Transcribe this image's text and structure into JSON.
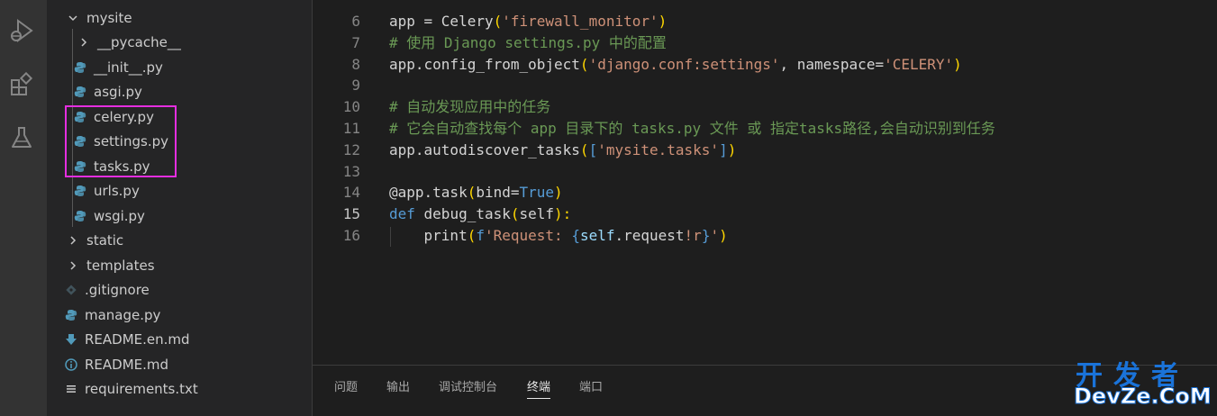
{
  "activity_bar": {
    "icons": [
      "run-debug-icon",
      "extensions-icon",
      "testing-flask-icon"
    ]
  },
  "explorer": {
    "items": [
      {
        "label": "mysite",
        "kind": "folder-open"
      },
      {
        "label": "__pycache__",
        "kind": "folder-closed"
      },
      {
        "label": "__init__.py",
        "kind": "python-file"
      },
      {
        "label": "asgi.py",
        "kind": "python-file"
      },
      {
        "label": "celery.py",
        "kind": "python-file"
      },
      {
        "label": "settings.py",
        "kind": "python-file"
      },
      {
        "label": "tasks.py",
        "kind": "python-file"
      },
      {
        "label": "urls.py",
        "kind": "python-file"
      },
      {
        "label": "wsgi.py",
        "kind": "python-file"
      },
      {
        "label": "static",
        "kind": "folder-closed"
      },
      {
        "label": "templates",
        "kind": "folder-closed"
      },
      {
        "label": ".gitignore",
        "kind": "git-file"
      },
      {
        "label": "manage.py",
        "kind": "python-file"
      },
      {
        "label": "README.en.md",
        "kind": "markdown-download-file"
      },
      {
        "label": "README.md",
        "kind": "markdown-info-file"
      },
      {
        "label": "requirements.txt",
        "kind": "text-file"
      }
    ],
    "highlight_color": "#e52ee0"
  },
  "editor": {
    "active_line": 15,
    "lines": [
      {
        "num": "6",
        "tokens": [
          {
            "t": "app = Celery",
            "c": "plain"
          },
          {
            "t": "(",
            "c": "brk"
          },
          {
            "t": "'firewall_monitor'",
            "c": "str"
          },
          {
            "t": ")",
            "c": "brk"
          }
        ]
      },
      {
        "num": "7",
        "tokens": [
          {
            "t": "# 使用 Django settings.py 中的配置",
            "c": "comment"
          }
        ]
      },
      {
        "num": "8",
        "tokens": [
          {
            "t": "app.config_from_object",
            "c": "plain"
          },
          {
            "t": "(",
            "c": "brk"
          },
          {
            "t": "'django.conf:settings'",
            "c": "str"
          },
          {
            "t": ", namespace=",
            "c": "plain"
          },
          {
            "t": "'CELERY'",
            "c": "str"
          },
          {
            "t": ")",
            "c": "brk"
          }
        ]
      },
      {
        "num": "9",
        "tokens": []
      },
      {
        "num": "10",
        "tokens": [
          {
            "t": "# 自动发现应用中的任务",
            "c": "comment"
          }
        ]
      },
      {
        "num": "11",
        "tokens": [
          {
            "t": "# 它会自动查找每个 app 目录下的 tasks.py 文件 或 指定tasks路径,会自动识别到任务",
            "c": "comment"
          }
        ]
      },
      {
        "num": "12",
        "tokens": [
          {
            "t": "app.autodiscover_tasks",
            "c": "plain"
          },
          {
            "t": "(",
            "c": "brk"
          },
          {
            "t": "[",
            "c": "kw"
          },
          {
            "t": "'mysite.tasks'",
            "c": "str"
          },
          {
            "t": "]",
            "c": "kw"
          },
          {
            "t": ")",
            "c": "brk"
          }
        ]
      },
      {
        "num": "13",
        "tokens": []
      },
      {
        "num": "14",
        "tokens": [
          {
            "t": "@app.task",
            "c": "plain"
          },
          {
            "t": "(",
            "c": "brk"
          },
          {
            "t": "bind=",
            "c": "plain"
          },
          {
            "t": "True",
            "c": "kw"
          },
          {
            "t": ")",
            "c": "brk"
          }
        ]
      },
      {
        "num": "15",
        "tokens": [
          {
            "t": "def",
            "c": "kw"
          },
          {
            "t": " debug_task",
            "c": "plain"
          },
          {
            "t": "(",
            "c": "brk"
          },
          {
            "t": "self",
            "c": "plain"
          },
          {
            "t": "):",
            "c": "brk"
          }
        ]
      },
      {
        "num": "16",
        "tokens": [
          {
            "t": "    print",
            "c": "plain"
          },
          {
            "t": "(",
            "c": "brk"
          },
          {
            "t": "f",
            "c": "kw"
          },
          {
            "t": "'Request: ",
            "c": "str"
          },
          {
            "t": "{",
            "c": "kw"
          },
          {
            "t": "self",
            "c": "param"
          },
          {
            "t": ".request",
            "c": "plain"
          },
          {
            "t": "!r",
            "c": "str"
          },
          {
            "t": "}",
            "c": "kw"
          },
          {
            "t": "'",
            "c": "str"
          },
          {
            "t": ")",
            "c": "brk"
          }
        ]
      }
    ]
  },
  "panel": {
    "tabs": [
      {
        "label": "问题",
        "active": false
      },
      {
        "label": "输出",
        "active": false
      },
      {
        "label": "调试控制台",
        "active": false
      },
      {
        "label": "终端",
        "active": true
      },
      {
        "label": "端口",
        "active": false
      }
    ]
  },
  "watermark": {
    "cn": "开发者",
    "en": "DevZe.CoM"
  }
}
